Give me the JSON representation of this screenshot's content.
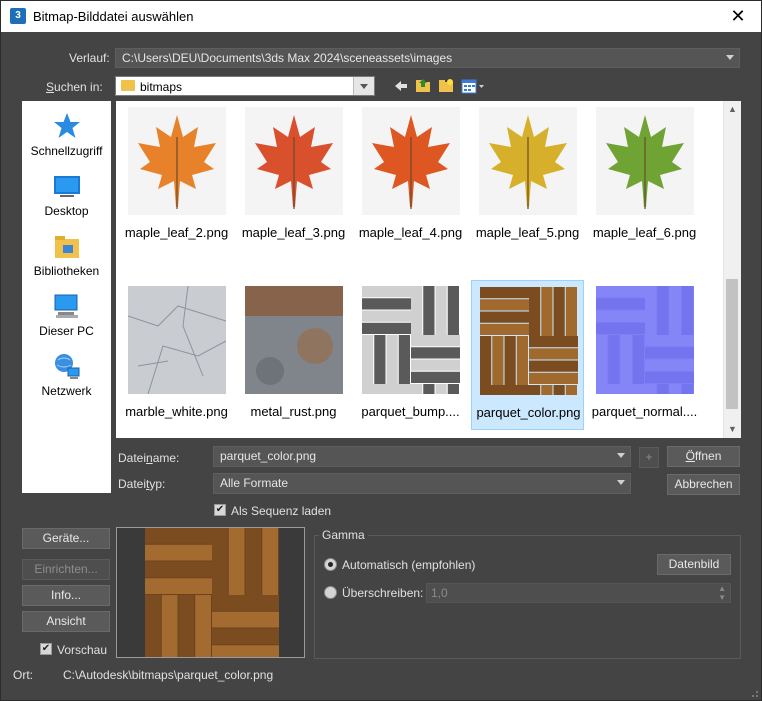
{
  "window": {
    "title": "Bitmap-Bilddatei auswählen",
    "app_icon": "3"
  },
  "history": {
    "label": "Verlauf:",
    "value": "C:\\Users\\DEU\\Documents\\3ds Max 2024\\sceneassets\\images"
  },
  "lookin": {
    "label": "Suchen in:",
    "value": "bitmaps"
  },
  "places": [
    {
      "label": "Schnellzugriff"
    },
    {
      "label": "Desktop"
    },
    {
      "label": "Bibliotheken"
    },
    {
      "label": "Dieser PC"
    },
    {
      "label": "Netzwerk"
    }
  ],
  "files": [
    {
      "name": "maple_leaf_2.png",
      "color": "#e8822a"
    },
    {
      "name": "maple_leaf_3.png",
      "color": "#d9502d"
    },
    {
      "name": "maple_leaf_4.png",
      "color": "#de5622"
    },
    {
      "name": "maple_leaf_5.png",
      "color": "#d6b02a"
    },
    {
      "name": "maple_leaf_6.png",
      "color": "#6fa334"
    },
    {
      "name": "marble_white.png"
    },
    {
      "name": "metal_rust.png"
    },
    {
      "name": "parquet_bump...."
    },
    {
      "name": "parquet_color.png"
    },
    {
      "name": "parquet_normal...."
    }
  ],
  "filename": {
    "label": "Dateiname:",
    "value": "parquet_color.png"
  },
  "filetype": {
    "label": "Dateityp:",
    "value": "Alle Formate"
  },
  "sequence": {
    "label": "Als Sequenz laden",
    "checked": true
  },
  "buttons": {
    "open": "Öffnen",
    "cancel": "Abbrechen",
    "plus": "+",
    "devices": "Geräte...",
    "setup": "Einrichten...",
    "info": "Info...",
    "view": "Ansicht",
    "datenbild": "Datenbild"
  },
  "preview_toggle": {
    "label": "Vorschau",
    "checked": true
  },
  "gamma": {
    "title": "Gamma",
    "auto_label": "Automatisch (empfohlen)",
    "override_label": "Überschreiben:",
    "override_value": "1,0"
  },
  "location": {
    "label": "Ort:",
    "value": "C:\\Autodesk\\bitmaps\\parquet_color.png"
  },
  "selected_file": "parquet_color.png"
}
